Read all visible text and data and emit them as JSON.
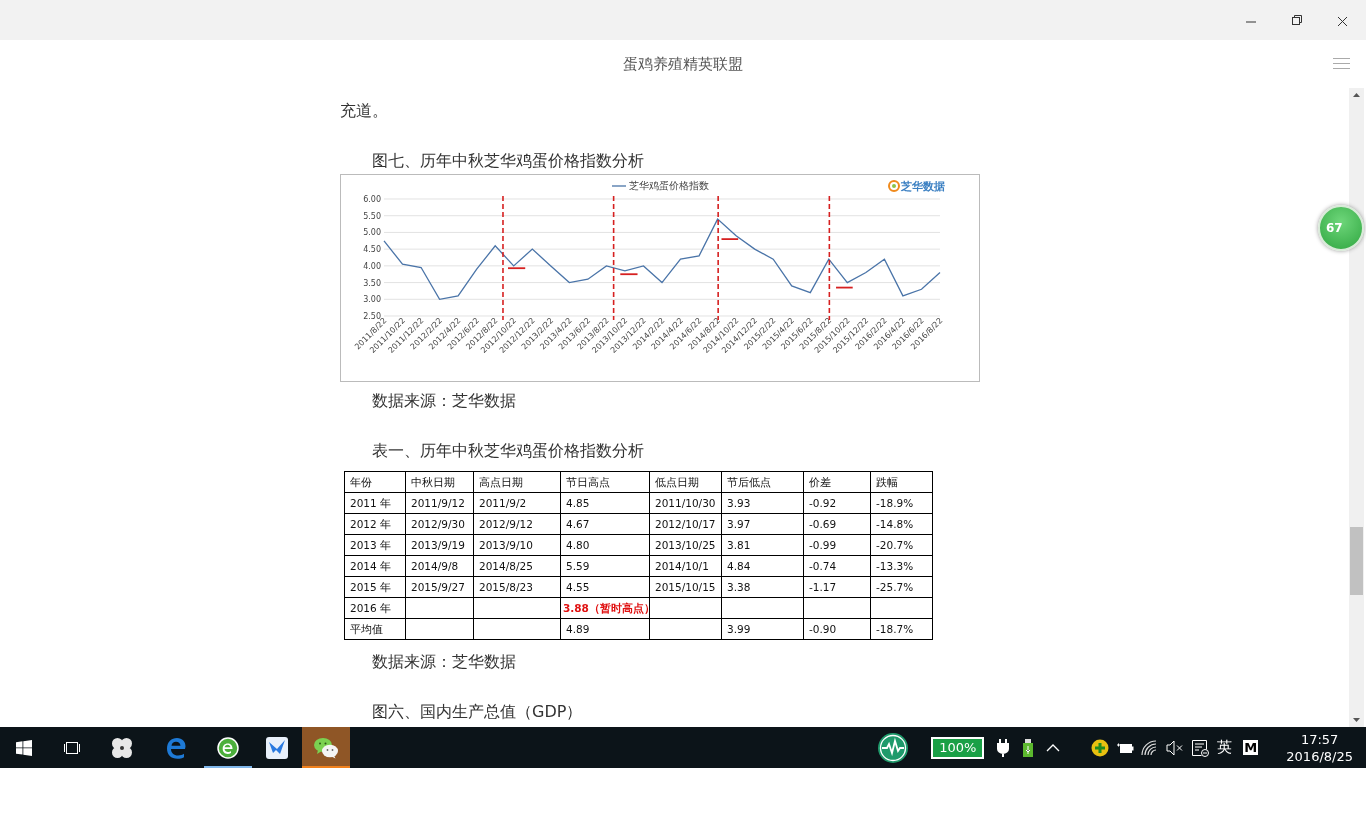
{
  "window": {
    "title": "蛋鸡养殖精英联盟"
  },
  "article": {
    "paragraph_end": "充道。",
    "figure_caption": "图七、历年中秋芝华鸡蛋价格指数分析",
    "chart": {
      "logo_text": "芝华数据",
      "chart_data": {
        "type": "line",
        "categories": [
          "2011/8/22",
          "2011/10/22",
          "2011/12/22",
          "2012/2/22",
          "2012/4/22",
          "2012/6/22",
          "2012/8/22",
          "2012/10/22",
          "2012/12/22",
          "2013/2/22",
          "2013/4/22",
          "2013/6/22",
          "2013/8/22",
          "2013/10/22",
          "2013/12/22",
          "2014/2/22",
          "2014/4/22",
          "2014/6/22",
          "2014/8/22",
          "2014/10/22",
          "2014/12/22",
          "2015/2/22",
          "2015/4/22",
          "2015/6/22",
          "2015/8/22",
          "2015/10/22",
          "2015/12/22",
          "2016/2/22",
          "2016/4/22",
          "2016/6/22",
          "2016/8/22"
        ],
        "series": [
          {
            "name": "芝华鸡蛋价格指数",
            "color": "#4a74a8",
            "values": [
              4.75,
              4.05,
              3.95,
              3.0,
              3.1,
              3.9,
              4.6,
              4.0,
              4.5,
              4.0,
              3.5,
              3.6,
              4.0,
              3.85,
              4.0,
              3.5,
              4.2,
              4.3,
              5.4,
              4.9,
              4.5,
              4.2,
              3.4,
              3.2,
              4.2,
              3.5,
              3.8,
              4.2,
              3.1,
              3.3,
              3.8
            ]
          }
        ],
        "ylim": [
          2.5,
          6
        ],
        "yticks": [
          {
            "value": 2.5,
            "label": "2.50"
          },
          {
            "value": 3,
            "label": "3.00"
          },
          {
            "value": 3.5,
            "label": "3.50"
          },
          {
            "value": 4,
            "label": "4.00"
          },
          {
            "value": 4.5,
            "label": "4.50"
          },
          {
            "value": 5,
            "label": "5.00"
          },
          {
            "value": 5.5,
            "label": "5.50"
          },
          {
            "value": 6,
            "label": "6.00"
          }
        ],
        "grid": true
      }
    },
    "chart_source": "数据来源：芝华数据",
    "table_caption": "表一、历年中秋芝华鸡蛋价格指数分析",
    "table": {
      "columns": [
        "年份",
        "中秋日期",
        "高点日期",
        "节日高点",
        "低点日期",
        "节后低点",
        "价差",
        "跌幅"
      ],
      "rows": [
        {
          "highlight": false,
          "cells": [
            "2011 年",
            "2011/9/12",
            "2011/9/2",
            "4.85",
            "2011/10/30",
            "3.93",
            "-0.92",
            "-18.9%"
          ]
        },
        {
          "highlight": false,
          "cells": [
            "2012 年",
            "2012/9/30",
            "2012/9/12",
            "4.67",
            "2012/10/17",
            "3.97",
            "-0.69",
            "-14.8%"
          ]
        },
        {
          "highlight": false,
          "cells": [
            "2013 年",
            "2013/9/19",
            "2013/9/10",
            "4.80",
            "2013/10/25",
            "3.81",
            "-0.99",
            "-20.7%"
          ]
        },
        {
          "highlight": false,
          "cells": [
            "2014 年",
            "2014/9/8",
            "2014/8/25",
            "5.59",
            "2014/10/1",
            "4.84",
            "-0.74",
            "-13.3%"
          ]
        },
        {
          "highlight": false,
          "cells": [
            "2015 年",
            "2015/9/27",
            "2015/8/23",
            "4.55",
            "2015/10/15",
            "3.38",
            "-1.17",
            "-25.7%"
          ]
        },
        {
          "highlight": true,
          "cells": [
            "2016 年",
            null,
            null,
            "3.88（暂时高点）",
            null,
            null,
            null,
            null
          ]
        },
        {
          "highlight": false,
          "cells": [
            "平均值",
            null,
            null,
            "4.89",
            null,
            "3.99",
            "-0.90",
            "-18.7%"
          ]
        }
      ]
    },
    "table_source": "数据来源：芝华数据",
    "next_caption": "图六、国内生产总值（GDP）"
  },
  "side_badge": "67",
  "taskbar": {
    "apps": [
      {
        "kind": "start",
        "running": false,
        "active": false
      },
      {
        "kind": "taskview",
        "running": false,
        "active": false
      },
      {
        "kind": "pinwheel",
        "running": false,
        "active": false
      },
      {
        "kind": "edge",
        "running": false,
        "active": false
      },
      {
        "kind": "globe",
        "running": true,
        "active": false
      },
      {
        "kind": "bird",
        "running": false,
        "active": false
      },
      {
        "kind": "chat",
        "running": true,
        "active": true
      }
    ],
    "battery_text": "100%",
    "input_language": "英",
    "ime_badge": "M",
    "time": "17:57",
    "date": "2016/8/25"
  }
}
